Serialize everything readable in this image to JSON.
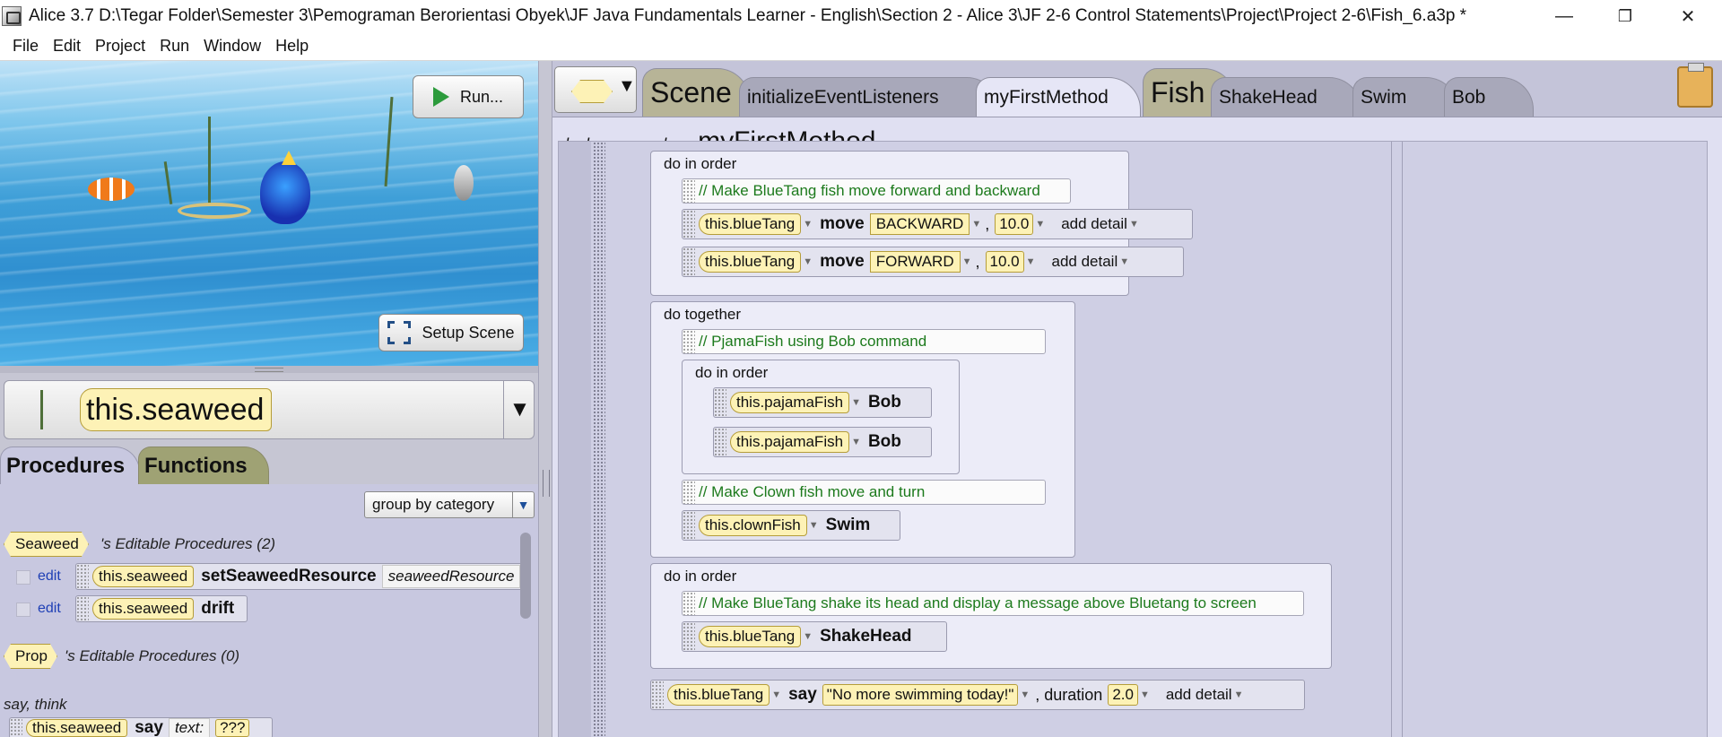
{
  "window": {
    "title": "Alice 3.7 D:\\Tegar Folder\\Semester 3\\Pemograman Berorientasi Obyek\\JF Java Fundamentals Learner - English\\Section 2 - Alice 3\\JF 2-6 Control Statements\\Project\\Project 2-6\\Fish_6.a3p *",
    "minimize": "—",
    "restore": "❐",
    "close": "✕"
  },
  "menu": [
    "File",
    "Edit",
    "Project",
    "Run",
    "Window",
    "Help"
  ],
  "scene": {
    "run_label": "Run...",
    "setup_label": "Setup Scene"
  },
  "selector": {
    "value": "this.seaweed",
    "arrow": "▼"
  },
  "left_tabs": {
    "procedures": "Procedures",
    "functions": "Functions"
  },
  "group_by": {
    "value": "group by category",
    "arrow": "▼"
  },
  "proc_list": {
    "seaweed_tag": "Seaweed",
    "seaweed_label": "'s Editable Procedures (2)",
    "edit": "edit",
    "item1_obj": "this.seaweed",
    "item1_method": "setSeaweedResource",
    "item1_param": "seaweedResource",
    "item2_obj": "this.seaweed",
    "item2_method": "drift",
    "prop_tag": "Prop",
    "prop_label": "'s Editable Procedures (0)",
    "category": "say, think",
    "say_obj": "this.seaweed",
    "say_method": "say",
    "say_text_label": "text:",
    "say_text_value": "???"
  },
  "editor_tabs": {
    "type_arrow": "▼",
    "scene": "Scene",
    "init": "initializeEventListeners",
    "first": "myFirstMethod",
    "fish": "Fish",
    "shake": "ShakeHead",
    "swim": "Swim",
    "bob": "Bob"
  },
  "declare": {
    "prefix": "declare procedure",
    "name": "myFirstMethod"
  },
  "code": {
    "block1_title": "do in order",
    "c1": "// Make BlueTang fish move forward and backward",
    "s1_obj": "this.blueTang",
    "s1_method": "move",
    "s1_dir": "BACKWARD",
    "s1_amount": "10.0",
    "s2_obj": "this.blueTang",
    "s2_method": "move",
    "s2_dir": "FORWARD",
    "s2_amount": "10.0",
    "add_detail": "add detail",
    "block2_title": "do together",
    "c2": "// PjamaFish using Bob command",
    "inner_title": "do in order",
    "s3_obj": "this.pajamaFish",
    "s3_method": "Bob",
    "s4_obj": "this.pajamaFish",
    "s4_method": "Bob",
    "c3": "// Make Clown fish move and turn",
    "s5_obj": "this.clownFish",
    "s5_method": "Swim",
    "block3_title": "do in order",
    "c4": "// Make BlueTang shake its head and display a message above Bluetang to screen",
    "s6_obj": "this.blueTang",
    "s6_method": "ShakeHead",
    "s7_obj": "this.blueTang",
    "s7_method": "say",
    "s7_text": "\"No more swimming today!\"",
    "s7_duration_label": ", duration",
    "s7_duration": "2.0"
  },
  "colors": {
    "object_pill": "#fdf2b6",
    "comment_text": "#1c7a1c",
    "panel_bg": "#c4c4d9"
  }
}
